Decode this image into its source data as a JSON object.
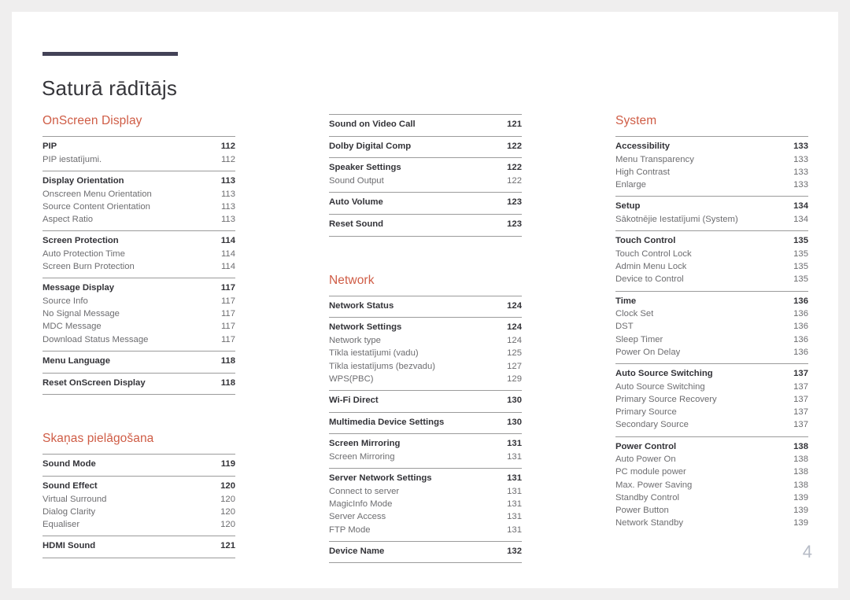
{
  "document": {
    "title": "Saturā rādītājs",
    "folio": "4",
    "accent_color": "#cf5c45",
    "rule_color": "#434257",
    "separator_color": "#9b9b9b",
    "main_text_color": "#333338",
    "sub_text_color": "#6d6d70",
    "folio_color": "#b6bbc6",
    "page_background": "#ffffff",
    "canvas_background": "#efeeee"
  },
  "columns": [
    {
      "name": "column-1",
      "sections": [
        {
          "heading": "OnScreen Display",
          "groups": [
            {
              "entries": [
                {
                  "label": "PIP",
                  "page": "112",
                  "level": "main"
                },
                {
                  "label": "PIP iestatījumi.",
                  "page": "112",
                  "level": "sub"
                }
              ]
            },
            {
              "entries": [
                {
                  "label": "Display Orientation",
                  "page": "113",
                  "level": "main"
                },
                {
                  "label": "Onscreen Menu Orientation",
                  "page": "113",
                  "level": "sub"
                },
                {
                  "label": "Source Content Orientation",
                  "page": "113",
                  "level": "sub"
                },
                {
                  "label": "Aspect Ratio",
                  "page": "113",
                  "level": "sub"
                }
              ]
            },
            {
              "entries": [
                {
                  "label": "Screen Protection",
                  "page": "114",
                  "level": "main"
                },
                {
                  "label": "Auto Protection Time",
                  "page": "114",
                  "level": "sub"
                },
                {
                  "label": "Screen Burn Protection",
                  "page": "114",
                  "level": "sub"
                }
              ]
            },
            {
              "entries": [
                {
                  "label": "Message Display",
                  "page": "117",
                  "level": "main"
                },
                {
                  "label": "Source Info",
                  "page": "117",
                  "level": "sub"
                },
                {
                  "label": "No Signal Message",
                  "page": "117",
                  "level": "sub"
                },
                {
                  "label": "MDC Message",
                  "page": "117",
                  "level": "sub"
                },
                {
                  "label": "Download Status Message",
                  "page": "117",
                  "level": "sub"
                }
              ]
            },
            {
              "entries": [
                {
                  "label": "Menu Language",
                  "page": "118",
                  "level": "main"
                }
              ]
            },
            {
              "last": true,
              "entries": [
                {
                  "label": "Reset OnScreen Display",
                  "page": "118",
                  "level": "main"
                }
              ]
            }
          ]
        },
        {
          "heading": "Skaņas pielāgošana",
          "spaced": true,
          "groups": [
            {
              "entries": [
                {
                  "label": "Sound Mode",
                  "page": "119",
                  "level": "main"
                }
              ]
            },
            {
              "entries": [
                {
                  "label": "Sound Effect",
                  "page": "120",
                  "level": "main"
                },
                {
                  "label": "Virtual Surround",
                  "page": "120",
                  "level": "sub"
                },
                {
                  "label": "Dialog Clarity",
                  "page": "120",
                  "level": "sub"
                },
                {
                  "label": "Equaliser",
                  "page": "120",
                  "level": "sub"
                }
              ]
            },
            {
              "last": true,
              "entries": [
                {
                  "label": "HDMI Sound",
                  "page": "121",
                  "level": "main"
                }
              ]
            }
          ]
        }
      ]
    },
    {
      "name": "column-2",
      "sections": [
        {
          "heading": "",
          "groups": [
            {
              "entries": [
                {
                  "label": "Sound on Video Call",
                  "page": "121",
                  "level": "main"
                }
              ]
            },
            {
              "entries": [
                {
                  "label": "Dolby Digital Comp",
                  "page": "122",
                  "level": "main"
                }
              ]
            },
            {
              "entries": [
                {
                  "label": "Speaker Settings",
                  "page": "122",
                  "level": "main"
                },
                {
                  "label": "Sound Output",
                  "page": "122",
                  "level": "sub"
                }
              ]
            },
            {
              "entries": [
                {
                  "label": "Auto Volume",
                  "page": "123",
                  "level": "main"
                }
              ]
            },
            {
              "last": true,
              "entries": [
                {
                  "label": "Reset Sound",
                  "page": "123",
                  "level": "main"
                }
              ]
            }
          ]
        },
        {
          "heading": "Network",
          "spaced": true,
          "groups": [
            {
              "entries": [
                {
                  "label": "Network Status",
                  "page": "124",
                  "level": "main"
                }
              ]
            },
            {
              "entries": [
                {
                  "label": "Network Settings",
                  "page": "124",
                  "level": "main"
                },
                {
                  "label": "Network type",
                  "page": "124",
                  "level": "sub"
                },
                {
                  "label": "Tīkla iestatījumi (vadu)",
                  "page": "125",
                  "level": "sub"
                },
                {
                  "label": "Tīkla iestatījums (bezvadu)",
                  "page": "127",
                  "level": "sub"
                },
                {
                  "label": "WPS(PBC)",
                  "page": "129",
                  "level": "sub"
                }
              ]
            },
            {
              "entries": [
                {
                  "label": "Wi-Fi Direct",
                  "page": "130",
                  "level": "main"
                }
              ]
            },
            {
              "entries": [
                {
                  "label": "Multimedia Device Settings",
                  "page": "130",
                  "level": "main"
                }
              ]
            },
            {
              "entries": [
                {
                  "label": "Screen Mirroring",
                  "page": "131",
                  "level": "main"
                },
                {
                  "label": "Screen Mirroring",
                  "page": "131",
                  "level": "sub"
                }
              ]
            },
            {
              "entries": [
                {
                  "label": "Server Network Settings",
                  "page": "131",
                  "level": "main"
                },
                {
                  "label": "Connect to server",
                  "page": "131",
                  "level": "sub"
                },
                {
                  "label": "MagicInfo Mode",
                  "page": "131",
                  "level": "sub"
                },
                {
                  "label": "Server Access",
                  "page": "131",
                  "level": "sub"
                },
                {
                  "label": "FTP Mode",
                  "page": "131",
                  "level": "sub"
                }
              ]
            },
            {
              "last": true,
              "entries": [
                {
                  "label": "Device Name",
                  "page": "132",
                  "level": "main"
                }
              ]
            }
          ]
        }
      ]
    },
    {
      "name": "column-3",
      "sections": [
        {
          "heading": "System",
          "groups": [
            {
              "entries": [
                {
                  "label": "Accessibility",
                  "page": "133",
                  "level": "main"
                },
                {
                  "label": "Menu Transparency",
                  "page": "133",
                  "level": "sub"
                },
                {
                  "label": "High Contrast",
                  "page": "133",
                  "level": "sub"
                },
                {
                  "label": "Enlarge",
                  "page": "133",
                  "level": "sub"
                }
              ]
            },
            {
              "entries": [
                {
                  "label": "Setup",
                  "page": "134",
                  "level": "main"
                },
                {
                  "label": "Sākotnējie Iestatījumi (System)",
                  "page": "134",
                  "level": "sub"
                }
              ]
            },
            {
              "entries": [
                {
                  "label": "Touch Control",
                  "page": "135",
                  "level": "main"
                },
                {
                  "label": "Touch Control Lock",
                  "page": "135",
                  "level": "sub"
                },
                {
                  "label": "Admin Menu Lock",
                  "page": "135",
                  "level": "sub"
                },
                {
                  "label": "Device to Control",
                  "page": "135",
                  "level": "sub"
                }
              ]
            },
            {
              "entries": [
                {
                  "label": "Time",
                  "page": "136",
                  "level": "main"
                },
                {
                  "label": "Clock Set",
                  "page": "136",
                  "level": "sub"
                },
                {
                  "label": "DST",
                  "page": "136",
                  "level": "sub"
                },
                {
                  "label": "Sleep Timer",
                  "page": "136",
                  "level": "sub"
                },
                {
                  "label": "Power On Delay",
                  "page": "136",
                  "level": "sub"
                }
              ]
            },
            {
              "entries": [
                {
                  "label": "Auto Source Switching",
                  "page": "137",
                  "level": "main"
                },
                {
                  "label": "Auto Source Switching",
                  "page": "137",
                  "level": "sub"
                },
                {
                  "label": "Primary Source Recovery",
                  "page": "137",
                  "level": "sub"
                },
                {
                  "label": "Primary Source",
                  "page": "137",
                  "level": "sub"
                },
                {
                  "label": "Secondary Source",
                  "page": "137",
                  "level": "sub"
                }
              ]
            },
            {
              "entries": [
                {
                  "label": "Power Control",
                  "page": "138",
                  "level": "main"
                },
                {
                  "label": "Auto Power On",
                  "page": "138",
                  "level": "sub"
                },
                {
                  "label": "PC module power",
                  "page": "138",
                  "level": "sub"
                },
                {
                  "label": "Max. Power Saving",
                  "page": "138",
                  "level": "sub"
                },
                {
                  "label": "Standby Control",
                  "page": "139",
                  "level": "sub"
                },
                {
                  "label": "Power Button",
                  "page": "139",
                  "level": "sub"
                },
                {
                  "label": "Network Standby",
                  "page": "139",
                  "level": "sub"
                }
              ]
            }
          ]
        }
      ]
    }
  ]
}
